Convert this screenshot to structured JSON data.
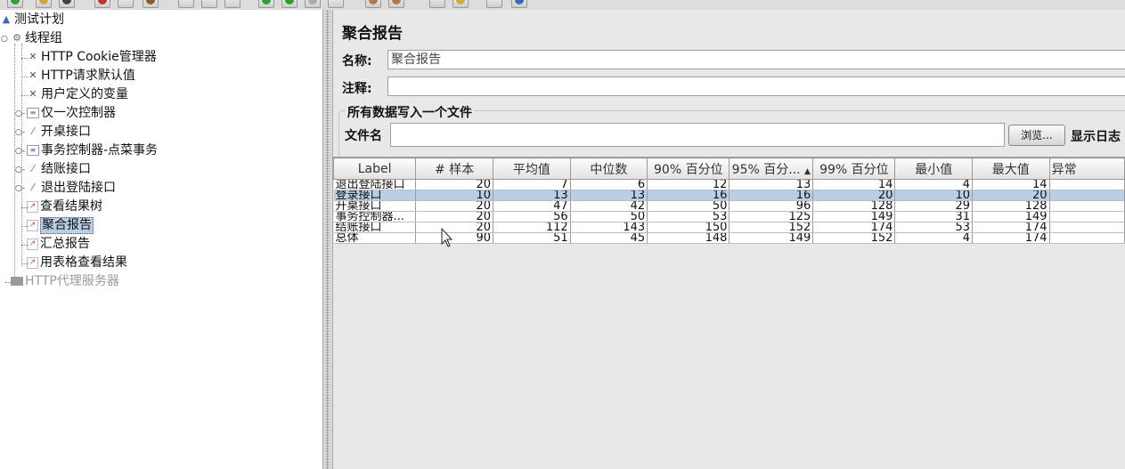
{
  "tree": {
    "items": [
      {
        "label": "测试计划",
        "icon": "test-plan-icon"
      },
      {
        "label": "线程组",
        "icon": "gear-icon"
      },
      {
        "label": "HTTP Cookie管理器",
        "icon": "config-tools-icon"
      },
      {
        "label": "HTTP请求默认值",
        "icon": "config-tools-icon"
      },
      {
        "label": "用户定义的变量",
        "icon": "config-tools-icon"
      },
      {
        "label": "仅一次控制器",
        "icon": "controller-icon"
      },
      {
        "label": "开桌接口",
        "icon": "sampler-pipette-icon"
      },
      {
        "label": "事务控制器-点菜事务",
        "icon": "controller-icon"
      },
      {
        "label": "结账接口",
        "icon": "sampler-pipette-icon"
      },
      {
        "label": "退出登陆接口",
        "icon": "sampler-pipette-icon"
      },
      {
        "label": "查看结果树",
        "icon": "listener-chart-icon"
      },
      {
        "label": "聚合报告",
        "icon": "listener-chart-icon"
      },
      {
        "label": "汇总报告",
        "icon": "listener-chart-icon"
      },
      {
        "label": "用表格查看结果",
        "icon": "listener-chart-icon"
      },
      {
        "label": "HTTP代理服务器",
        "icon": "proxy-icon"
      }
    ]
  },
  "panel": {
    "title": "聚合报告",
    "name_label": "名称:",
    "name_value": "聚合报告",
    "comment_label": "注释:",
    "comment_value": "",
    "group_title": "所有数据写入一个文件",
    "filename_label": "文件名",
    "filename_value": "",
    "browse_button": "浏览...",
    "show_log_label": "显示日志"
  },
  "table": {
    "columns": [
      "Label",
      "# 样本",
      "平均值",
      "中位数",
      "90% 百分位",
      "95% 百分...",
      "99% 百分位",
      "最小值",
      "最大值",
      "异常"
    ],
    "sort_indicator": "▲",
    "selected_row": 1,
    "rows": [
      [
        "退出登陆接口",
        "20",
        "7",
        "6",
        "12",
        "13",
        "14",
        "4",
        "14",
        ""
      ],
      [
        "登录接口",
        "10",
        "13",
        "13",
        "16",
        "16",
        "20",
        "10",
        "20",
        ""
      ],
      [
        "开桌接口",
        "20",
        "47",
        "42",
        "50",
        "96",
        "128",
        "29",
        "128",
        ""
      ],
      [
        "事务控制器...",
        "20",
        "56",
        "50",
        "53",
        "125",
        "149",
        "31",
        "149",
        ""
      ],
      [
        "结账接口",
        "20",
        "112",
        "143",
        "150",
        "152",
        "174",
        "53",
        "174",
        ""
      ],
      [
        "总体",
        "90",
        "51",
        "45",
        "148",
        "149",
        "152",
        "4",
        "174",
        ""
      ]
    ]
  },
  "colors": {
    "selection": "#b8cfe5",
    "panel_bg": "#e8e8e8"
  }
}
